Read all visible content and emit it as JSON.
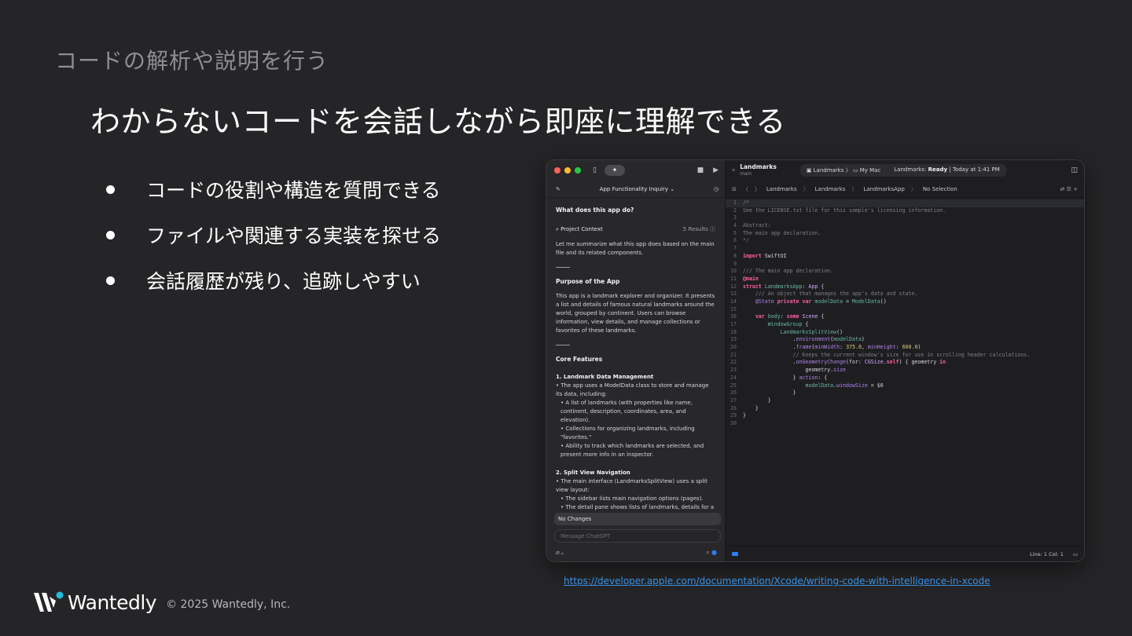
{
  "slide": {
    "section_title": "コードの解析や説明を行う",
    "headline": "わからないコードを会話しながら即座に理解できる",
    "bullets": [
      "コードの役割や構造を質問できる",
      "ファイルや関連する実装を探せる",
      "会話履歴が残り、追跡しやすい"
    ],
    "link": "https://developer.apple.com/documentation/Xcode/writing-code-with-intelligence-in-xcode",
    "footer": {
      "brand": "Wantedly",
      "copyright": "© 2025 Wantedly, Inc."
    }
  },
  "xcode": {
    "left": {
      "conversation_title": "App Functionality Inquiry ⌄",
      "question": "What does this app do?",
      "context_label": "Project Context",
      "context_results": "5 Results",
      "intro": "Let me summarize what this app does based on the main file and its related components.",
      "purpose_heading": "Purpose of the App",
      "purpose_text": "This app is a landmark explorer and organizer. It presents a list and details of famous natural landmarks around the world, grouped by continent. Users can browse information, view details, and manage collections or favorites of these landmarks.",
      "core_heading": "Core Features",
      "f1_title": "1. Landmark Data Management",
      "f1_line1": "• The app uses a ModelData class to store and manage its data, including:",
      "f1_line2": "• A list of landmarks (with properties like name, continent, description, coordinates, area, and elevation).",
      "f1_line3": "• Collections for organizing landmarks, including \"favorites.\"",
      "f1_line4": "• Ability to track which landmarks are selected, and present more info in an inspector.",
      "f2_title": "2. Split View Navigation",
      "f2_line1": "• The main interface (LandmarksSplitView) uses a split view layout:",
      "f2_line2": "• The sidebar lists main navigation options (pages).",
      "f2_line3": "• The detail pane shows lists of landmarks, details for a",
      "no_changes": "No Changes",
      "message_placeholder": "Message ChatGPT"
    },
    "right": {
      "project_name": "Landmarks",
      "branch": "main",
      "scheme": "Landmarks",
      "destination": "My Mac",
      "status_prefix": "Landmarks: ",
      "status_state": "Ready",
      "status_time": " | Today at 1:41 PM",
      "breadcrumbs": [
        "Landmarks",
        "Landmarks",
        "LandmarksApp",
        "No Selection"
      ],
      "cursor": "Line: 1  Col: 1",
      "line_numbers": [
        "1",
        "2",
        "3",
        "4",
        "5",
        "6",
        "7",
        "8",
        "9",
        "10",
        "11",
        "12",
        "13",
        "14",
        "15",
        "16",
        "17",
        "18",
        "19",
        "20",
        "21",
        "22",
        "23",
        "24",
        "25",
        "26",
        "27",
        "28",
        "29",
        "30"
      ]
    }
  }
}
